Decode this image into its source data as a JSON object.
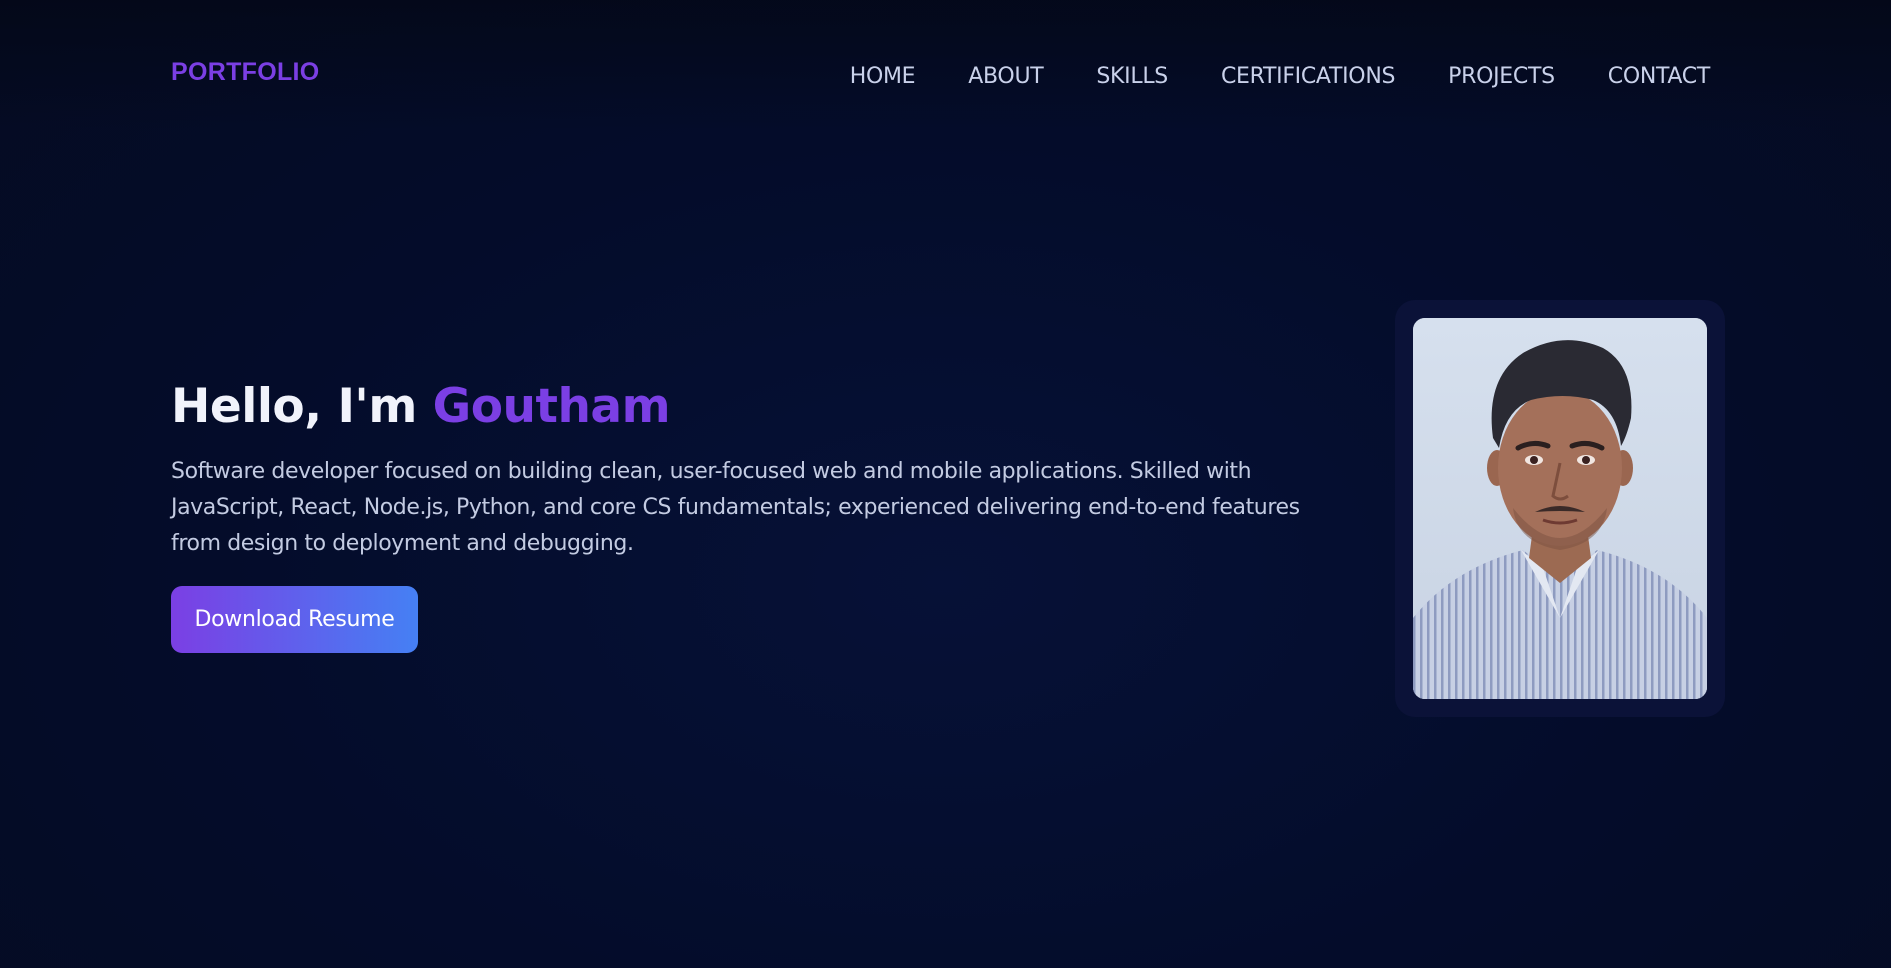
{
  "brand": {
    "logo_text": "PORTFOLIO"
  },
  "nav": {
    "items": [
      {
        "label": "HOME"
      },
      {
        "label": "ABOUT"
      },
      {
        "label": "SKILLS"
      },
      {
        "label": "CERTIFICATIONS"
      },
      {
        "label": "PROJECTS"
      },
      {
        "label": "CONTACT"
      }
    ]
  },
  "hero": {
    "greeting": "Hello, I'm ",
    "name": "Goutham",
    "description": "Software developer focused on building clean, user-focused web and mobile applications. Skilled with JavaScript, React, Node.js, Python, and core CS fundamentals; experienced delivering end-to-end features from design to deployment and debugging.",
    "cta_label": "Download Resume"
  },
  "colors": {
    "accent": "#7b3fe4",
    "gradient_end": "#4580f4",
    "background": "#050c28"
  }
}
